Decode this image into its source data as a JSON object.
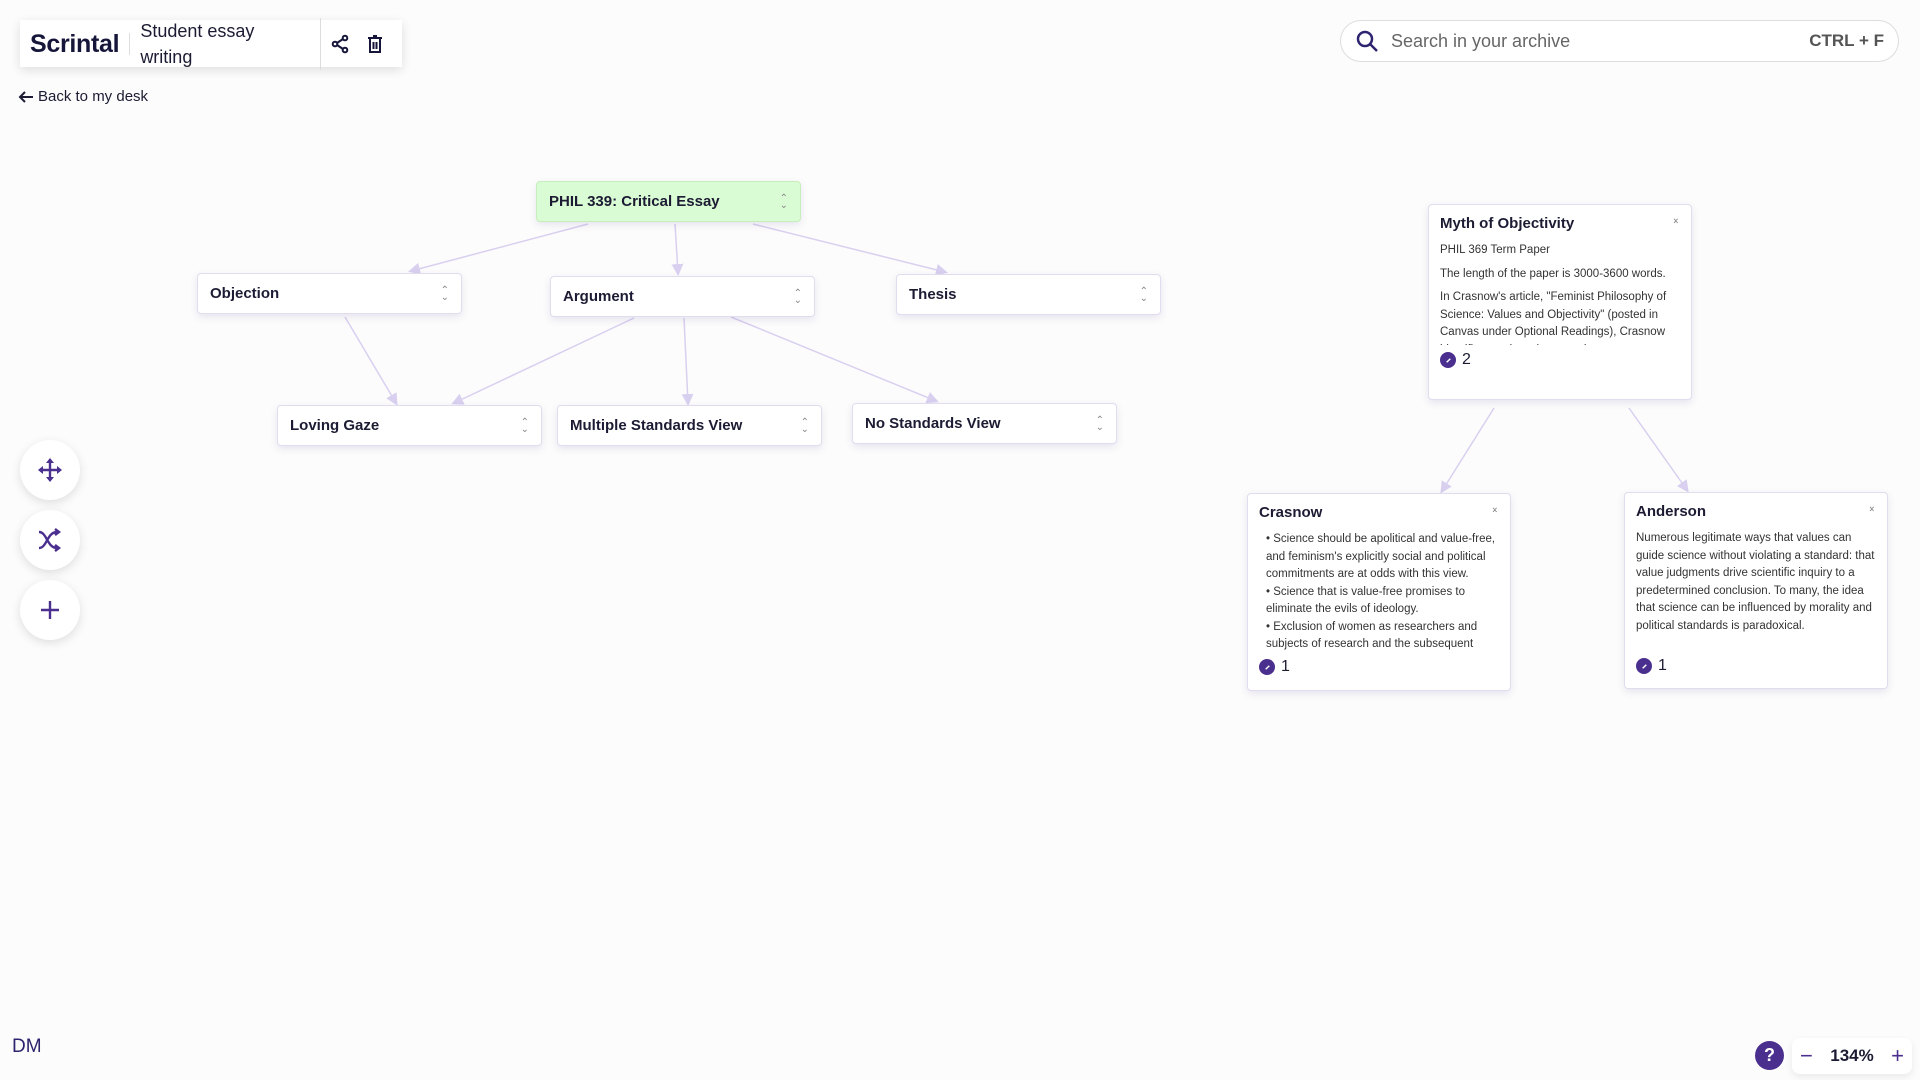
{
  "header": {
    "logo": "Scrintal",
    "board_title": "Student essay writing",
    "share_icon": "share-icon",
    "delete_icon": "trash-icon"
  },
  "back_link": "Back to my desk",
  "search": {
    "placeholder": "Search in your archive",
    "shortcut": "CTRL + F"
  },
  "nodes": {
    "root": "PHIL 339: Critical Essay",
    "objection": "Objection",
    "argument": "Argument",
    "thesis": "Thesis",
    "loving_gaze": "Loving Gaze",
    "multiple": "Multiple Standards View",
    "no_standards": "No Standards View"
  },
  "cards": {
    "myth": {
      "title": "Myth of Objectivity",
      "lines": [
        "PHIL 369 Term Paper",
        "The length of the paper is 3000-3600 words.",
        "In Crasnow's article, \"Feminist Philosophy of Science: Values and Objectivity\" (posted in Canvas under Optional Readings), Crasnow identifies two board approaches."
      ],
      "links": "2"
    },
    "crasnow": {
      "title": "Crasnow",
      "lines": [
        "• Science should be apolitical and value-free, and feminism's explicitly social and political commitments are at odds with this view.",
        "• Science that is value-free promises to eliminate the evils of ideology.",
        "• Exclusion of women as researchers and subjects of research and the subsequent"
      ],
      "links": "1"
    },
    "anderson": {
      "title": "Anderson",
      "lines": [
        "Numerous legitimate ways that values can guide science without violating a standard: that value judgments drive scientific inquiry to a predetermined conclusion. To many, the idea that science can be influenced by morality and political standards is paradoxical."
      ],
      "links": "1"
    }
  },
  "tools": [
    "move-icon",
    "shuffle-icon",
    "plus-icon"
  ],
  "user_initials": "DM",
  "zoom": {
    "help": "?",
    "level": "134%"
  },
  "colors": {
    "accent": "#4a2f8f",
    "root_node": "#dafcd4",
    "edge": "#d9d0f0"
  }
}
